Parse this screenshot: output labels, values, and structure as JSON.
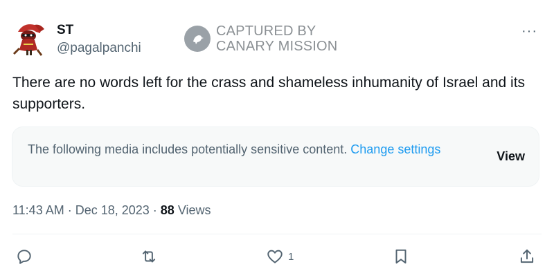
{
  "author": {
    "name": "ST",
    "handle": "@pagalpanchi"
  },
  "watermark": {
    "line1": "CAPTURED BY",
    "line2": "CANARY MISSION"
  },
  "more_label": "···",
  "tweet": {
    "text": "There are no words left for the crass and shameless inhumanity of Israel and its supporters."
  },
  "sensitive_notice": {
    "message": "The following media includes potentially sensitive content.",
    "link_label": "Change settings",
    "view_label": "View"
  },
  "meta": {
    "time": "11:43 AM",
    "separator1": " · ",
    "date": "Dec 18, 2023",
    "separator2": " · ",
    "views_count": "88",
    "views_label": " Views"
  },
  "actions": {
    "reply_icon": "reply-icon",
    "retweet_icon": "retweet-icon",
    "like_icon": "heart-icon",
    "like_count": "1",
    "bookmark_icon": "bookmark-icon",
    "share_icon": "share-icon"
  },
  "colors": {
    "text_primary": "#0f1419",
    "text_secondary": "#536471",
    "link": "#1d9bf0",
    "media_bg": "#f7f9f9",
    "watermark": "#8b9094"
  }
}
